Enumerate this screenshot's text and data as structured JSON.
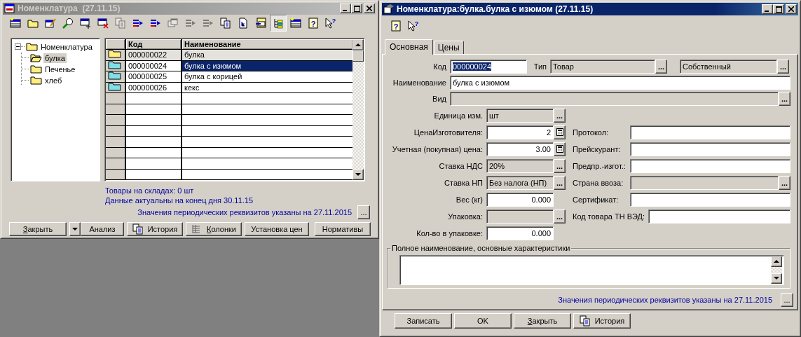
{
  "list_window": {
    "title": "Номенклатура  (27.11.15)",
    "active": false,
    "toolbar": [
      {
        "kind": "table",
        "disabled": false,
        "selected": false
      },
      {
        "kind": "folder",
        "disabled": false,
        "selected": false
      },
      {
        "kind": "edit",
        "disabled": false,
        "selected": false
      },
      {
        "kind": "search",
        "disabled": false,
        "selected": false
      },
      {
        "kind": "add",
        "disabled": false,
        "selected": false
      },
      {
        "kind": "delete",
        "disabled": false,
        "selected": false
      },
      {
        "kind": "copy",
        "disabled": true,
        "selected": false
      },
      {
        "kind": "move",
        "disabled": false,
        "selected": false
      },
      {
        "kind": "move",
        "disabled": false,
        "selected": false
      },
      {
        "kind": "windows",
        "disabled": true,
        "selected": false
      },
      {
        "kind": "move",
        "disabled": true,
        "selected": false
      },
      {
        "kind": "move",
        "disabled": true,
        "selected": false
      },
      {
        "kind": "copy",
        "disabled": false,
        "selected": false
      },
      {
        "kind": "doc",
        "disabled": false,
        "selected": false
      },
      {
        "kind": "import",
        "disabled": false,
        "selected": false
      },
      {
        "kind": "tree",
        "disabled": false,
        "selected": true
      },
      {
        "kind": "table",
        "disabled": false,
        "selected": false
      },
      {
        "kind": "help",
        "glyph": "?",
        "disabled": false,
        "selected": false
      },
      {
        "kind": "pointer",
        "glyph": "?",
        "disabled": false,
        "selected": false
      }
    ],
    "tree": {
      "label": "Номенклатура",
      "expanded": true,
      "children": [
        {
          "label": "булка",
          "selected": true
        },
        {
          "label": "Печенье",
          "selected": false
        },
        {
          "label": "хлеб",
          "selected": false
        }
      ]
    },
    "table": {
      "columns": [
        "Код",
        "Наименование"
      ],
      "rows": [
        {
          "kind": "group",
          "code": "000000022",
          "name": "булка",
          "selected": false
        },
        {
          "kind": "item",
          "code": "000000024",
          "name": "булка с изюмом",
          "selected": true
        },
        {
          "kind": "item",
          "code": "000000025",
          "name": "булка с корицей",
          "selected": false
        },
        {
          "kind": "item",
          "code": "000000026",
          "name": "кекс",
          "selected": false
        }
      ]
    },
    "info": [
      "Товары на складах: 0 шт",
      "Данные актуальны на конец дня 30.11.15"
    ],
    "periodic_note": "Значения периодических реквизитов указаны на 27.11.2015",
    "more_button": "...",
    "buttons": [
      {
        "label": "Закрыть",
        "mnemonic": true,
        "dropdown": true
      },
      {
        "label": "Анализ",
        "mnemonic": false
      },
      {
        "label": "История",
        "mnemonic": false,
        "kind": "copies"
      },
      {
        "label": "Колонки",
        "mnemonic": true,
        "kind": "columns"
      },
      {
        "label": "Установка цен",
        "mnemonic": false
      },
      {
        "label": "Нормативы",
        "mnemonic": false
      }
    ]
  },
  "item_window": {
    "title": "Номенклатура:булка.булка с изюмом (27.11.15)",
    "active": true,
    "toolbar": [
      {
        "kind": "help",
        "glyph": "?"
      },
      {
        "kind": "pointer",
        "glyph": "?"
      }
    ],
    "tabs": [
      {
        "label": "Основная",
        "selected": true
      },
      {
        "label": "Цены",
        "selected": false
      }
    ],
    "code": {
      "label": "Код",
      "value": "000000024",
      "text_selected": true
    },
    "type": {
      "label": "Тип",
      "value": "Товар",
      "button": "..."
    },
    "origin": {
      "value": "Собственный",
      "button": "..."
    },
    "name": {
      "label": "Наименование",
      "value": "булка с изюмом"
    },
    "view": {
      "label": "Вид",
      "button": "..."
    },
    "left_fields": [
      {
        "kind": "ref",
        "label": "Единица изм.",
        "value": "шт",
        "button": "..."
      },
      {
        "kind": "calc",
        "label": "ЦенаИзготовителя:",
        "value": "2"
      },
      {
        "kind": "calc",
        "label": "Учетная (покупная) цена:",
        "value": "3.00"
      },
      {
        "kind": "ref",
        "label": "Ставка НДС",
        "value": "20%",
        "button": "..."
      },
      {
        "kind": "ref",
        "label": "Ставка НП",
        "value": "Без налога (НП)",
        "button": "..."
      },
      {
        "kind": "number",
        "label": "Вес (кг)",
        "value": "0.000"
      },
      {
        "kind": "ref",
        "label": "Упаковка:",
        "button": "..."
      },
      {
        "kind": "number",
        "label": "Кол-во в упаковке:",
        "value": "0.000"
      }
    ],
    "right_fields": [
      {
        "kind": "text",
        "label": "Протокол:"
      },
      {
        "kind": "text",
        "label": "Прейскурант:"
      },
      {
        "kind": "text",
        "label": "Предпр.-изгот.:"
      },
      {
        "kind": "ref",
        "label": "Страна ввоза:",
        "button": "..."
      },
      {
        "kind": "text",
        "label": "Сертификат:"
      },
      {
        "kind": "text",
        "label": "Код товара ТН ВЭД:"
      }
    ],
    "full_description": {
      "label": "Полное наименование, основные характеристики"
    },
    "periodic_note": "Значения периодических реквизитов указаны на 27.11.2015",
    "more_button": "...",
    "buttons": [
      {
        "label": "Записать",
        "mnemonic": false
      },
      {
        "label": "OK",
        "mnemonic": false
      },
      {
        "label": "Закрыть",
        "mnemonic": true
      },
      {
        "label": "История",
        "mnemonic": false,
        "kind": "copies"
      }
    ]
  }
}
